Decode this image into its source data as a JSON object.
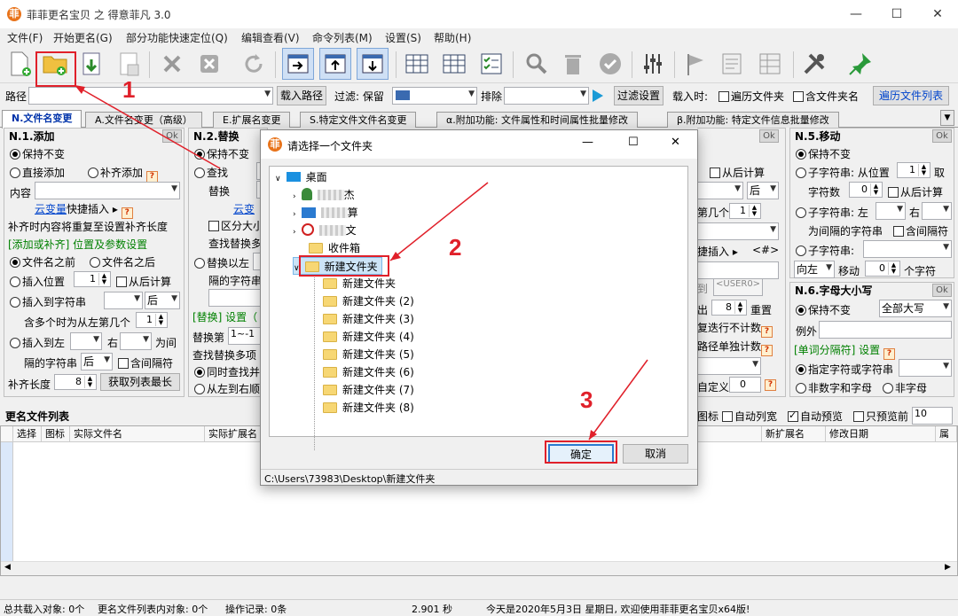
{
  "window": {
    "app_icon": "菲",
    "title": "菲菲更名宝贝 之 得意菲凡 3.0",
    "minimize": "—",
    "maximize": "☐",
    "close": "✕"
  },
  "menu": [
    "文件(F)",
    "开始更名(G)",
    "部分功能快速定位(Q)",
    "编辑查看(V)",
    "命令列表(M)",
    "设置(S)",
    "帮助(H)"
  ],
  "pathbar": {
    "path_label": "路径",
    "load_path": "载入路径",
    "filter_label": "过滤: 保留",
    "exclude_label": "排除",
    "filter_settings": "过滤设置",
    "load_time_label": "载入时:",
    "traverse_subfolders": "遍历文件夹",
    "include_folder_name": "含文件夹名",
    "traverse_list": "遍历文件列表"
  },
  "tabs": [
    "N.文件名变更",
    "A.文件名变更（高级）",
    "E.扩展名变更",
    "S.特定文件文件名变更",
    "α.附加功能: 文件属性和时间属性批量修改",
    "β.附加功能: 特定文件信息批量修改"
  ],
  "panel_add": {
    "title": "N.1.添加",
    "ok": "Ok",
    "keep": "保持不变",
    "direct_add": "直接添加",
    "pad_add": "补齐添加",
    "content_label": "内容",
    "cloud_var": "云变量",
    "quick_insert": "快捷插入 ▸",
    "pad_note": "补齐时内容将重复至设置补齐长度",
    "pos_header": "[添加或补齐] 位置及参数设置",
    "before_name": "文件名之前",
    "after_name": "文件名之后",
    "insert_pos": "插入位置",
    "insert_pos_val": "1",
    "from_back": "从后计算",
    "insert_to_str": "插入到字符串",
    "after": "后",
    "multi_note": "含多个时为从左第几个",
    "multi_val": "1",
    "insert_left": "插入到左",
    "right": "右",
    "for_interval": "为间",
    "interval_str": "隔的字符串",
    "after2": "后",
    "include_sep": "含间隔符",
    "pad_len": "补齐长度",
    "pad_len_val": "8",
    "get_max": "获取列表最长"
  },
  "panel_replace": {
    "title": "N.2.替换",
    "keep": "保持不变",
    "find": "查找",
    "replace": "替换",
    "cloud_var": "云变",
    "case": "区分大小",
    "replace_more": "查找替换多",
    "replace_left": "替换以左",
    "interval_str": "隔的字符串",
    "hdr": "[替换] 设置（",
    "replace_nth": "替换第",
    "replace_nth_val": "1~-1",
    "find_multi": "查找替换多项",
    "sync_find": "同时查找并",
    "left_to_right": "从左到右顺"
  },
  "panel_mid": {
    "from_back": "从后计算",
    "after": "后",
    "nth": "第几个",
    "nth_val": "1",
    "quick_insert": "捷插入 ▸",
    "var_tag": "<#>",
    "user_tag": "<USER0>",
    "rep_label": "出",
    "rep_val": "8",
    "reset": "重置",
    "skip_note": "复迭行不计数",
    "path_count": "路径单独计数",
    "custom": "自定义",
    "custom_val": "0"
  },
  "panel_move": {
    "title": "N.5.移动",
    "ok": "Ok",
    "keep": "保持不变",
    "substr": "子字符串: 从位置",
    "pos_val": "1",
    "take": "取",
    "char_count": "字符数",
    "char_val": "0",
    "from_back": "从后计算",
    "substr_left": "子字符串: 左",
    "right": "右",
    "interval_str": "为间隔的字符串",
    "include_sep": "含间隔符",
    "substr2": "子字符串:",
    "dir": "向左",
    "move": "移动",
    "move_val": "0",
    "chars": "个字符"
  },
  "panel_case": {
    "title": "N.6.字母大小写",
    "ok": "Ok",
    "keep": "保持不变",
    "all_upper": "全部大写",
    "exception": "例外",
    "word_sep_hdr": "[单词分隔符] 设置",
    "specify": "指定字符或字符串",
    "non_alnum": "非数字和字母",
    "non_letter": "非字母"
  },
  "list": {
    "title": "更名文件列表",
    "icon_opt": "图标",
    "auto_width": "自动列宽",
    "auto_preview": "自动预览",
    "preview_only": "只预览前",
    "preview_n": "10",
    "cols": [
      "选择",
      "图标",
      "实际文件名",
      "实际扩展名"
    ],
    "cols_right": [
      "新扩展名",
      "修改日期",
      "属"
    ]
  },
  "status": {
    "total": "总共载入对象: 0个",
    "list_count": "更名文件列表内对象: 0个",
    "ops": "操作记录: 0条",
    "time": "2.901 秒",
    "msg": "今天是2020年5月3日 星期日, 欢迎使用菲菲更名宝贝x64版!"
  },
  "dialog": {
    "title": "请选择一个文件夹",
    "minimize": "—",
    "maximize": "☐",
    "close": "✕",
    "root": "桌面",
    "item1": "杰",
    "item2": "算",
    "item3": "文",
    "item4": "收件箱",
    "selected": "新建文件夹",
    "children": [
      "新建文件夹",
      "新建文件夹 (2)",
      "新建文件夹 (3)",
      "新建文件夹 (4)",
      "新建文件夹 (5)",
      "新建文件夹 (6)",
      "新建文件夹 (7)",
      "新建文件夹 (8)"
    ],
    "ok": "确定",
    "cancel": "取消",
    "path": "C:\\Users\\73983\\Desktop\\新建文件夹"
  },
  "annotations": {
    "n1": "1",
    "n2": "2",
    "n3": "3",
    "color": "#e0202a"
  }
}
